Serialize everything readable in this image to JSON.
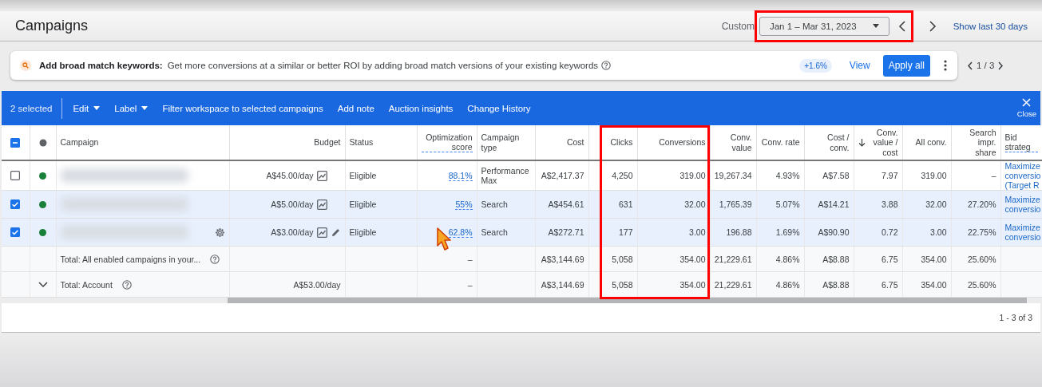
{
  "header": {
    "title": "Campaigns",
    "range_label": "Custom",
    "date_range": {
      "value": "Jan 1 – Mar 31, 2023",
      "highlighted": true
    },
    "show_last": "Show last 30 days"
  },
  "recommendation": {
    "title": "Add broad match keywords:",
    "text": "Get more conversions at a similar or better ROI by adding broad match versions of your existing keywords",
    "uplift": "+1.6%",
    "view": "View",
    "apply": "Apply all",
    "pager": "1 / 3"
  },
  "selection_bar": {
    "count": "2 selected",
    "actions": [
      {
        "label": "Edit",
        "dropdown": true
      },
      {
        "label": "Label",
        "dropdown": true
      },
      {
        "label": "Filter workspace to selected campaigns",
        "dropdown": false
      },
      {
        "label": "Add note",
        "dropdown": false
      },
      {
        "label": "Auction insights",
        "dropdown": false
      },
      {
        "label": "Change History",
        "dropdown": false
      }
    ],
    "close": "Close"
  },
  "table": {
    "select_all_indeterminate": true,
    "columns": [
      {
        "label": "Campaign"
      },
      {
        "label": "Budget"
      },
      {
        "label": "Status"
      },
      {
        "label": "Optimization score",
        "underlined": true
      },
      {
        "label": "Campaign type"
      },
      {
        "label": "Cost"
      },
      {
        "label": "Clicks",
        "highlighted": true
      },
      {
        "label": "Conversions",
        "highlighted": true
      },
      {
        "label": "Conv. value"
      },
      {
        "label": "Conv. rate"
      },
      {
        "label": "Cost / conv."
      },
      {
        "label": "Conv. value / cost",
        "sorted_descending": true
      },
      {
        "label": "All conv."
      },
      {
        "label": "Search impr. share"
      },
      {
        "label": "Bid strateg",
        "underlined": true
      }
    ],
    "rows": [
      {
        "kind": "campaign",
        "selected": false,
        "color": "#188038",
        "budget": "A$45.00/day",
        "status": "Eligible",
        "opt_score": "88.1%",
        "type": "Performance Max",
        "metrics": [
          "A$2,417.37",
          "4,250",
          "319.00",
          "19,267.34",
          "4.93%",
          "A$7.58",
          "7.97",
          "319.00",
          "–"
        ],
        "bid_strategy": "Maximize conversio (Target R"
      },
      {
        "kind": "campaign",
        "selected": true,
        "color": "#188038",
        "budget": "A$5.00/day",
        "status": "Eligible",
        "opt_score": "55%",
        "type": "Search",
        "metrics": [
          "A$454.61",
          "631",
          "32.00",
          "1,765.39",
          "5.07%",
          "A$14.21",
          "3.88",
          "32.00",
          "27.20%"
        ],
        "bid_strategy": "Maximize conversio"
      },
      {
        "kind": "campaign",
        "selected": true,
        "color": "#188038",
        "hovered": true,
        "budget": "A$3.00/day",
        "status": "Eligible",
        "opt_score": "62.8%",
        "type": "Search",
        "metrics": [
          "A$272.71",
          "177",
          "3.00",
          "196.88",
          "1.69%",
          "A$90.90",
          "0.72",
          "3.00",
          "22.75%"
        ],
        "bid_strategy": "Maximize conversio"
      },
      {
        "kind": "total",
        "label": "Total: All enabled campaigns in your...",
        "opt_score": "–",
        "metrics": [
          "A$3,144.69",
          "5,058",
          "354.00",
          "21,229.61",
          "4.86%",
          "A$8.88",
          "6.75",
          "354.00",
          "25.60%"
        ]
      },
      {
        "kind": "total",
        "expandable": true,
        "label": "Total: Account",
        "budget": "A$53.00/day",
        "opt_score": "–",
        "metrics": [
          "A$3,144.69",
          "5,058",
          "354.00",
          "21,229.61",
          "4.86%",
          "A$8.88",
          "6.75",
          "354.00",
          "25.60%"
        ]
      }
    ],
    "footer": "1 - 3 of 3"
  }
}
